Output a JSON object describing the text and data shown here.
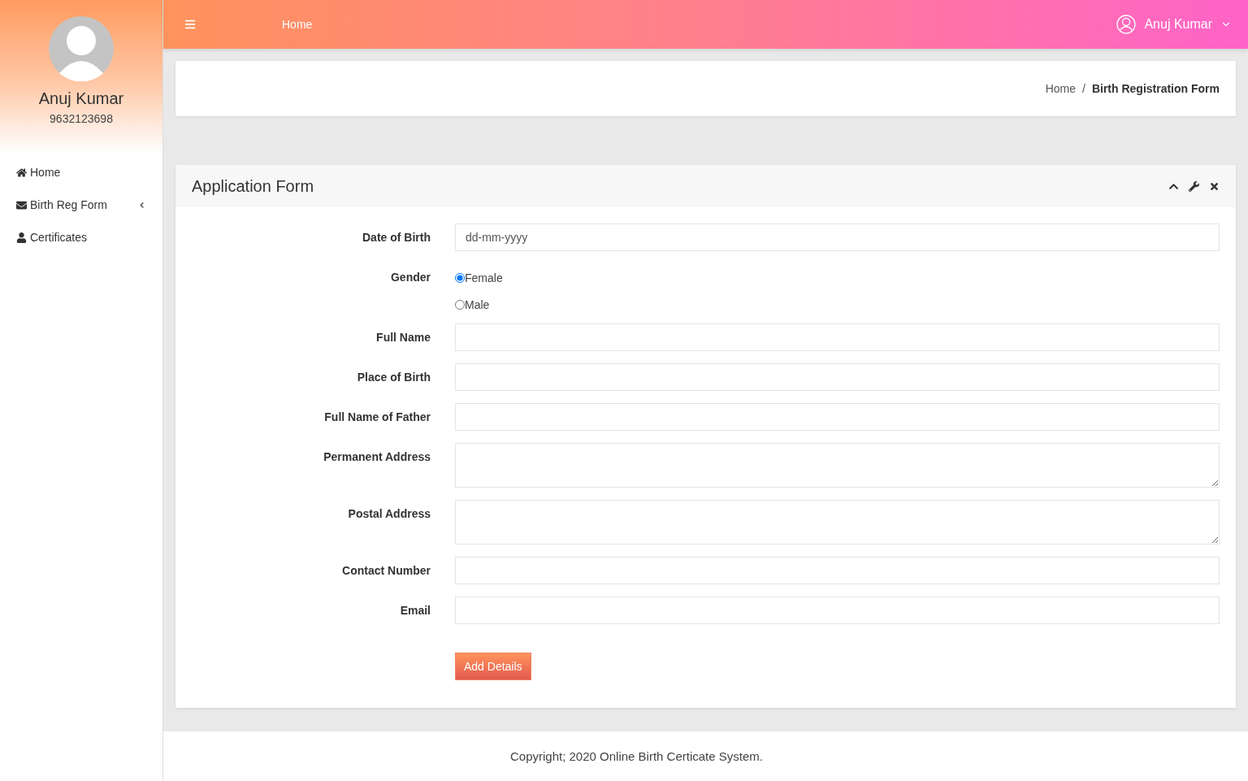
{
  "sidebar": {
    "user": {
      "name": "Anuj Kumar",
      "phone": "9632123698"
    },
    "items": [
      {
        "kind": "home",
        "label": "Home",
        "submenu": false
      },
      {
        "kind": "mail",
        "label": "Birth Reg Form",
        "submenu": true
      },
      {
        "kind": "user",
        "label": "Certificates",
        "submenu": false
      }
    ]
  },
  "topbar": {
    "title": "Home",
    "user": "Anuj Kumar"
  },
  "breadcrumb": {
    "items": [
      "Home",
      "Birth Registration Form"
    ],
    "separator": "/"
  },
  "panel": {
    "title": "Application Form",
    "fields": [
      {
        "kind": "input",
        "label": "Date of Birth",
        "placeholder": "dd-mm-yyyy"
      },
      {
        "kind": "radio",
        "label": "Gender",
        "options": [
          {
            "label": "Female",
            "selected": true
          },
          {
            "label": "Male",
            "selected": false
          }
        ]
      },
      {
        "kind": "input",
        "label": "Full Name"
      },
      {
        "kind": "input",
        "label": "Place of Birth"
      },
      {
        "kind": "input",
        "label": "Full Name of Father"
      },
      {
        "kind": "textarea",
        "label": "Permanent Address"
      },
      {
        "kind": "textarea",
        "label": "Postal Address"
      },
      {
        "kind": "input",
        "label": "Contact Number"
      },
      {
        "kind": "input",
        "label": "Email"
      }
    ],
    "submit": "Add Details"
  },
  "footer": "Copyright; 2020 Online Birth Certicate System."
}
